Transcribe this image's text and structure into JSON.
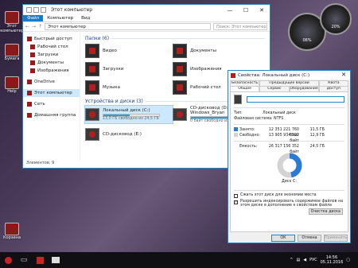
{
  "desktop": {
    "icons": [
      {
        "label": "Этот компьютер"
      },
      {
        "label": "Бумага"
      },
      {
        "label": "Help"
      },
      {
        "label": "Корзина"
      }
    ]
  },
  "gadgets": {
    "cpu_percent": "06%",
    "ram_percent": "20%"
  },
  "explorer": {
    "qa_title": "Этот компьютер",
    "ribbon": [
      "Файл",
      "Компьютер",
      "Вид"
    ],
    "address": "Этот компьютер",
    "search_placeholder": "Поиск: Этот компьютер",
    "nav_items": [
      {
        "label": "Быстрый доступ"
      },
      {
        "label": "Рабочий стол"
      },
      {
        "label": "Загрузки"
      },
      {
        "label": "Документы"
      },
      {
        "label": "Изображения"
      },
      {
        "label": "OneDrive"
      },
      {
        "label": "Этот компьютер"
      },
      {
        "label": "Сеть"
      },
      {
        "label": "Домашняя группа"
      }
    ],
    "folders_header": "Папки (6)",
    "folders": [
      {
        "label": "Видео"
      },
      {
        "label": "Документы"
      },
      {
        "label": "Загрузки"
      },
      {
        "label": "Изображения"
      },
      {
        "label": "Музыка"
      },
      {
        "label": "Рабочий стол"
      }
    ],
    "devices_header": "Устройства и диски (3)",
    "drives": [
      {
        "label": "Локальный диск (C:)",
        "sub": "13,0 ГБ свободно из 24,5 ГБ",
        "fill": 0.47
      },
      {
        "label": "CD-дисковод (D:) Windows_Bryan",
        "sub": "0 байт свободно из 3,68 ГБ",
        "fill": 1.0
      },
      {
        "label": "CD-дисковод (E:)"
      }
    ],
    "status": "Элементов: 9"
  },
  "props": {
    "title": "Свойства: Локальный диск (C:)",
    "tabs": [
      "Безопасность",
      "Предыдущие версии",
      "Квота",
      "Общие",
      "Сервис",
      "Оборудование",
      "Доступ"
    ],
    "name_value": "",
    "type_key": "Тип:",
    "type_val": "Локальный диск",
    "fs_key": "Файловая система:",
    "fs_val": "NTFS",
    "used": {
      "k": "Занято:",
      "b": "12 351 221 760 байт",
      "g": "11,5 ГБ"
    },
    "free": {
      "k": "Свободно:",
      "b": "13 905 934 592 байт",
      "g": "12,9 ГБ"
    },
    "cap": {
      "k": "Емкость:",
      "b": "26 317 156 352 байт",
      "g": "24,5 ГБ"
    },
    "used_fraction": 0.47,
    "disk_label": "Диск C:",
    "cleanup": "Очистка диска",
    "compress": "Сжать этот диск для экономии места",
    "index": "Разрешить индексировать содержимое файлов на этом диске в дополнение к свойствам файла",
    "ok": "ОК",
    "cancel": "Отмена",
    "apply": "Применить",
    "colors": {
      "used": "#2b7ad6",
      "free": "#d3d3d3"
    }
  },
  "taskbar": {
    "lang": "РУС",
    "time": "14:56",
    "date": "05.11.2016"
  }
}
